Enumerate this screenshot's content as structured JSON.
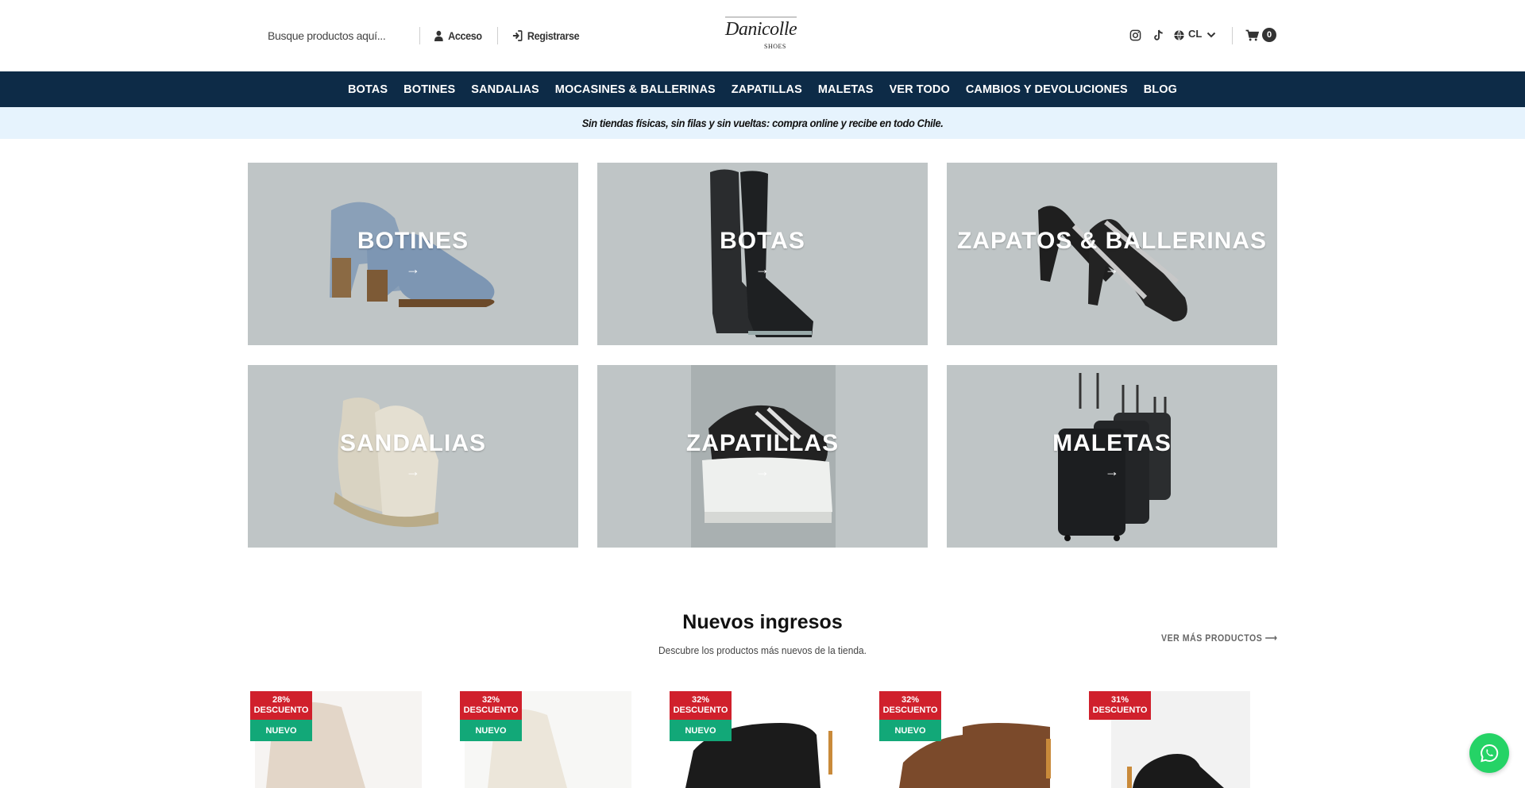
{
  "header": {
    "search_placeholder": "Busque productos aquí...",
    "login_label": "Acceso",
    "register_label": "Registrarse",
    "logo_text": "Danicolle",
    "logo_sub": "SHOES",
    "country": "CL",
    "cart_count": "0"
  },
  "nav": {
    "items": [
      "BOTAS",
      "BOTINES",
      "SANDALIAS",
      "MOCASINES & BALLERINAS",
      "ZAPATILLAS",
      "MALETAS",
      "VER TODO",
      "CAMBIOS Y DEVOLUCIONES",
      "BLOG"
    ]
  },
  "banner": {
    "text": "Sin tiendas físicas, sin filas y sin vueltas: compra online y recibe en todo Chile."
  },
  "categories": [
    {
      "title": "BOTINES",
      "arrow": "→"
    },
    {
      "title": "BOTAS",
      "arrow": "→"
    },
    {
      "title": "ZAPATOS & BALLERINAS",
      "arrow": "→"
    },
    {
      "title": "SANDALIAS",
      "arrow": "→"
    },
    {
      "title": "ZAPATILLAS",
      "arrow": "→"
    },
    {
      "title": "MALETAS",
      "arrow": "→"
    }
  ],
  "new_arrivals": {
    "title": "Nuevos ingresos",
    "subtitle": "Descubre los productos más nuevos de la tienda.",
    "more_label": "VER MÁS PRODUCTOS",
    "products": [
      {
        "discount_pct": "28%",
        "discount_label": "DESCUENTO",
        "new_label": "NUEVO"
      },
      {
        "discount_pct": "32%",
        "discount_label": "DESCUENTO",
        "new_label": "NUEVO"
      },
      {
        "discount_pct": "32%",
        "discount_label": "DESCUENTO",
        "new_label": "NUEVO"
      },
      {
        "discount_pct": "32%",
        "discount_label": "DESCUENTO",
        "new_label": "NUEVO"
      },
      {
        "discount_pct": "31%",
        "discount_label": "DESCUENTO",
        "new_label": ""
      }
    ]
  },
  "colors": {
    "nav_bg": "#0d2b47",
    "banner_bg": "#e6f3fd",
    "category_bg": "#bfc5c6",
    "discount_badge": "#d0202c",
    "new_badge": "#12a878",
    "whatsapp": "#25d366"
  },
  "icons": [
    "user-icon",
    "sign-in-icon",
    "instagram-icon",
    "tiktok-icon",
    "globe-icon",
    "chevron-down-icon",
    "cart-icon",
    "arrow-right-icon",
    "whatsapp-icon"
  ]
}
